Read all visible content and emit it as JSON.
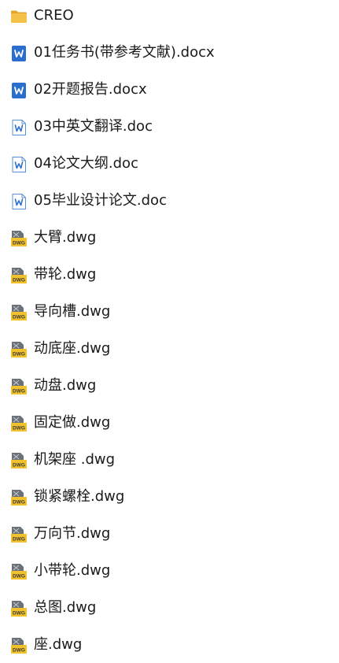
{
  "files": [
    {
      "name": "CREO",
      "icon": "folder-icon"
    },
    {
      "name": "01任务书(带参考文献).docx",
      "icon": "word-doc-icon"
    },
    {
      "name": "02开题报告.docx",
      "icon": "word-doc-icon"
    },
    {
      "name": "03中英文翻译.doc",
      "icon": "word-doc-legacy-icon"
    },
    {
      "name": "04论文大纲.doc",
      "icon": "word-doc-legacy-icon"
    },
    {
      "name": "05毕业设计论文.doc",
      "icon": "word-doc-legacy-icon"
    },
    {
      "name": "大臂.dwg",
      "icon": "dwg-file-icon"
    },
    {
      "name": "带轮.dwg",
      "icon": "dwg-file-icon"
    },
    {
      "name": "导向槽.dwg",
      "icon": "dwg-file-icon"
    },
    {
      "name": "动底座.dwg",
      "icon": "dwg-file-icon"
    },
    {
      "name": "动盘.dwg",
      "icon": "dwg-file-icon"
    },
    {
      "name": "固定做.dwg",
      "icon": "dwg-file-icon"
    },
    {
      "name": "机架座 .dwg",
      "icon": "dwg-file-icon"
    },
    {
      "name": "锁紧螺栓.dwg",
      "icon": "dwg-file-icon"
    },
    {
      "name": "万向节.dwg",
      "icon": "dwg-file-icon"
    },
    {
      "name": "小带轮.dwg",
      "icon": "dwg-file-icon"
    },
    {
      "name": "总图.dwg",
      "icon": "dwg-file-icon"
    },
    {
      "name": "座.dwg",
      "icon": "dwg-file-icon"
    }
  ],
  "icon_badge_text": "DWG",
  "colors": {
    "folder": "#F5C249",
    "folder_dark": "#E3A52A",
    "word_blue": "#2B6FCE",
    "dwg_yellow": "#F2C12E",
    "dwg_gray": "#5A6068",
    "text": "#1A1A1A"
  }
}
